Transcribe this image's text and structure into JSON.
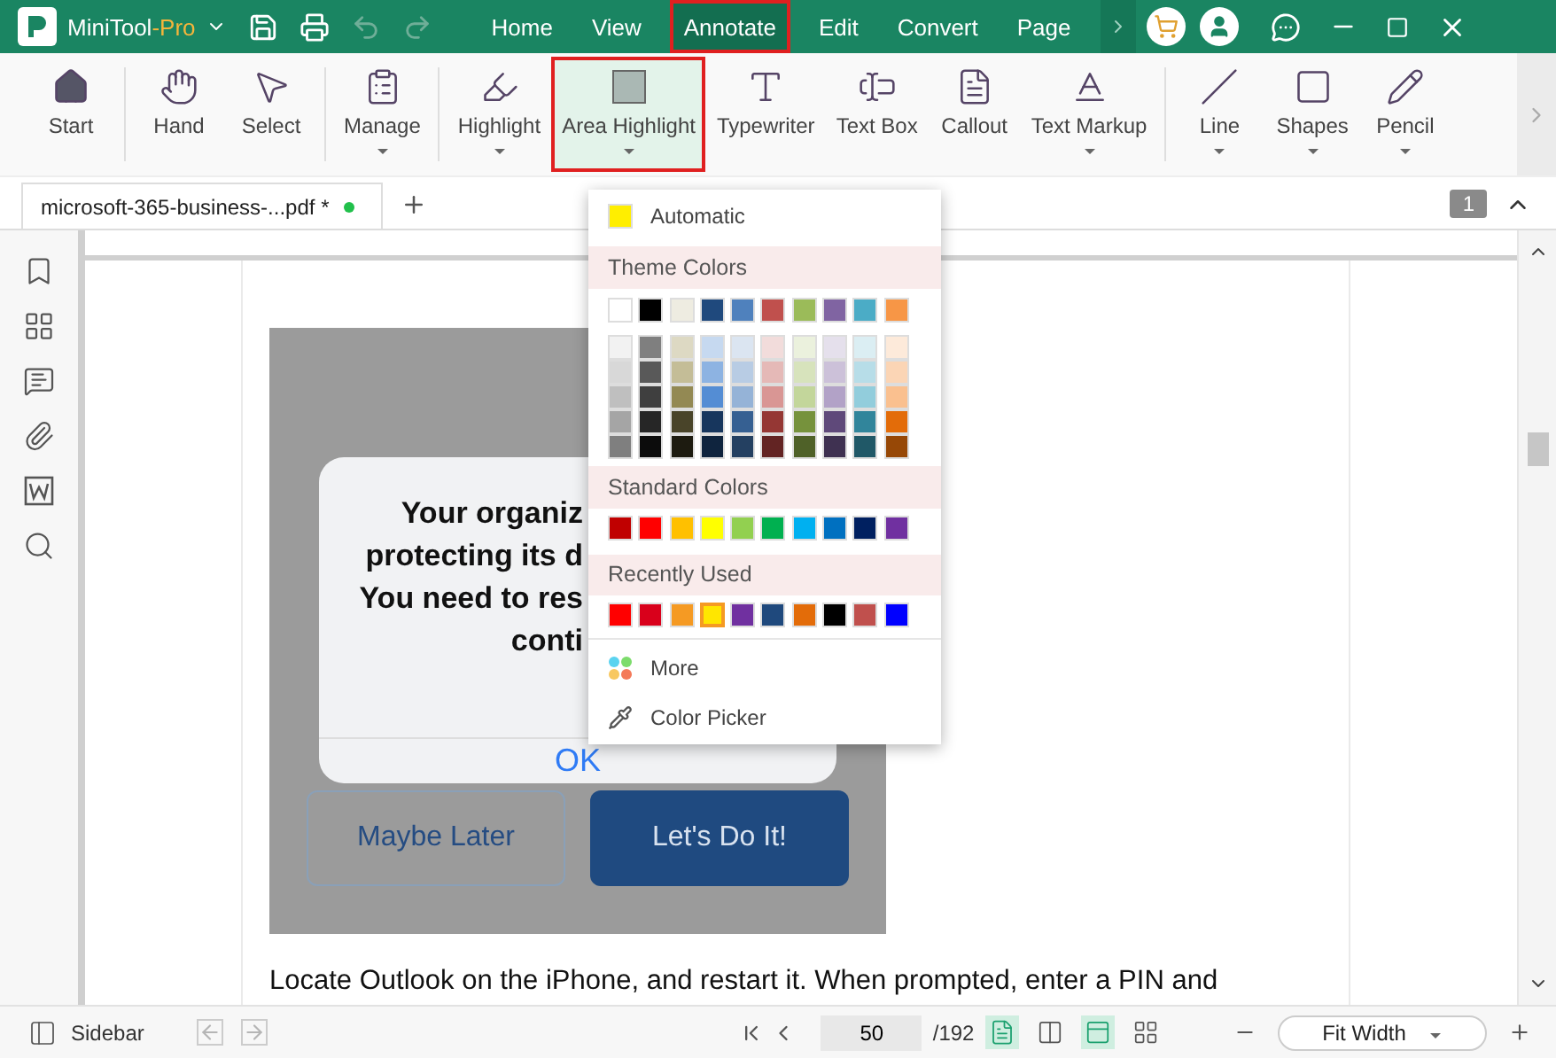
{
  "app": {
    "name": "MiniTool",
    "edition": "-Pro",
    "undo_disabled": true,
    "redo_disabled": true
  },
  "menu": [
    {
      "label": "Home",
      "selected": false
    },
    {
      "label": "View",
      "selected": false
    },
    {
      "label": "Annotate",
      "selected": true
    },
    {
      "label": "Edit",
      "selected": false
    },
    {
      "label": "Convert",
      "selected": false
    },
    {
      "label": "Page",
      "selected": false
    }
  ],
  "tool_groups": [
    {
      "tools": [
        {
          "label": "Start",
          "dropdown": false,
          "selected": false
        }
      ]
    },
    {
      "tools": [
        {
          "label": "Hand",
          "dropdown": false,
          "selected": false
        },
        {
          "label": "Select",
          "dropdown": false,
          "selected": false
        }
      ]
    },
    {
      "tools": [
        {
          "label": "Manage",
          "dropdown": true,
          "selected": false
        }
      ]
    },
    {
      "tools": [
        {
          "label": "Highlight",
          "dropdown": true,
          "selected": false
        },
        {
          "label": "Area Highlight",
          "dropdown": true,
          "selected": true
        },
        {
          "label": "Typewriter",
          "dropdown": false,
          "selected": false
        },
        {
          "label": "Text Box",
          "dropdown": false,
          "selected": false
        },
        {
          "label": "Callout",
          "dropdown": false,
          "selected": false
        },
        {
          "label": "Text Markup",
          "dropdown": true,
          "selected": false
        }
      ]
    },
    {
      "tools": [
        {
          "label": "Line",
          "dropdown": true,
          "selected": false
        },
        {
          "label": "Shapes",
          "dropdown": true,
          "selected": false
        },
        {
          "label": "Pencil",
          "dropdown": true,
          "selected": false
        }
      ]
    }
  ],
  "document_tab": {
    "title": "microsoft-365-business-...pdf *",
    "unsaved": true
  },
  "page_badge": "1",
  "color_menu": {
    "automatic": {
      "label": "Automatic",
      "color": "#ffee00"
    },
    "theme": {
      "title": "Theme Colors",
      "base": [
        {
          "color": "#ffffff"
        },
        {
          "color": "#000000"
        },
        {
          "color": "#eeece1"
        },
        {
          "color": "#1f497d"
        },
        {
          "color": "#4f81bd"
        },
        {
          "color": "#c0504d"
        },
        {
          "color": "#9bbb59"
        },
        {
          "color": "#8064a2"
        },
        {
          "color": "#4bacc6"
        },
        {
          "color": "#f79646"
        }
      ],
      "shades": [
        {
          "swatches": [
            {
              "color": "#f2f2f2"
            },
            {
              "color": "#7f7f7f"
            },
            {
              "color": "#ddd9c3"
            },
            {
              "color": "#c6d9f0"
            },
            {
              "color": "#dbe5f1"
            },
            {
              "color": "#f2dcdb"
            },
            {
              "color": "#ebf1dd"
            },
            {
              "color": "#e5e0ec"
            },
            {
              "color": "#dbeef3"
            },
            {
              "color": "#fdeada"
            }
          ]
        },
        {
          "swatches": [
            {
              "color": "#d8d8d8"
            },
            {
              "color": "#595959"
            },
            {
              "color": "#c4bd97"
            },
            {
              "color": "#8db3e2"
            },
            {
              "color": "#b8cce4"
            },
            {
              "color": "#e5b9b7"
            },
            {
              "color": "#d7e3bc"
            },
            {
              "color": "#ccc1d9"
            },
            {
              "color": "#b7dde8"
            },
            {
              "color": "#fbd5b5"
            }
          ]
        },
        {
          "swatches": [
            {
              "color": "#bfbfbf"
            },
            {
              "color": "#3f3f3f"
            },
            {
              "color": "#938953"
            },
            {
              "color": "#548dd4"
            },
            {
              "color": "#95b3d7"
            },
            {
              "color": "#d99694"
            },
            {
              "color": "#c3d69b"
            },
            {
              "color": "#b2a2c7"
            },
            {
              "color": "#92cddc"
            },
            {
              "color": "#fac08f"
            }
          ]
        },
        {
          "swatches": [
            {
              "color": "#a5a5a5"
            },
            {
              "color": "#262626"
            },
            {
              "color": "#494429"
            },
            {
              "color": "#17365d"
            },
            {
              "color": "#366092"
            },
            {
              "color": "#953734"
            },
            {
              "color": "#76923c"
            },
            {
              "color": "#5f497a"
            },
            {
              "color": "#31859b"
            },
            {
              "color": "#e36c09"
            }
          ]
        },
        {
          "swatches": [
            {
              "color": "#7f7f7f"
            },
            {
              "color": "#0c0c0c"
            },
            {
              "color": "#1d1b10"
            },
            {
              "color": "#0f243e"
            },
            {
              "color": "#244061"
            },
            {
              "color": "#632423"
            },
            {
              "color": "#4f6128"
            },
            {
              "color": "#3f3151"
            },
            {
              "color": "#205867"
            },
            {
              "color": "#974806"
            }
          ]
        }
      ]
    },
    "standard": {
      "title": "Standard Colors",
      "swatches": [
        {
          "color": "#c00000"
        },
        {
          "color": "#ff0000"
        },
        {
          "color": "#ffc000"
        },
        {
          "color": "#ffff00"
        },
        {
          "color": "#92d050"
        },
        {
          "color": "#00b050"
        },
        {
          "color": "#00b0f0"
        },
        {
          "color": "#0070c0"
        },
        {
          "color": "#002060"
        },
        {
          "color": "#7030a0"
        }
      ]
    },
    "recent": {
      "title": "Recently Used",
      "swatches": [
        {
          "color": "#ff0000",
          "selected": false
        },
        {
          "color": "#d9001b",
          "selected": false
        },
        {
          "color": "#f59a23",
          "selected": false
        },
        {
          "color": "#ffe600",
          "selected": true
        },
        {
          "color": "#7030a0",
          "selected": false
        },
        {
          "color": "#1f497d",
          "selected": false
        },
        {
          "color": "#e36c09",
          "selected": false
        },
        {
          "color": "#000000",
          "selected": false
        },
        {
          "color": "#c0504d",
          "selected": false
        },
        {
          "color": "#0000ff",
          "selected": false
        }
      ]
    },
    "more": "More",
    "picker": "Color Picker"
  },
  "document": {
    "dialog_lines": [
      "Your organiz",
      "protecting its d",
      "You need to res",
      "conti"
    ],
    "dialog_ok": "OK",
    "secondary_button": "Maybe Later",
    "primary_button": "Let's Do It!",
    "paragraph": "Locate Outlook on the iPhone, and restart it. When prompted, enter a PIN and"
  },
  "status_bar": {
    "sidebar_label": "Sidebar",
    "back_disabled": true,
    "forward_disabled": true,
    "page": "50",
    "total": "/192",
    "view_modes": [
      {
        "selected": true
      },
      {
        "selected": false
      },
      {
        "selected": true
      },
      {
        "selected": false
      }
    ],
    "zoom": "Fit Width"
  }
}
